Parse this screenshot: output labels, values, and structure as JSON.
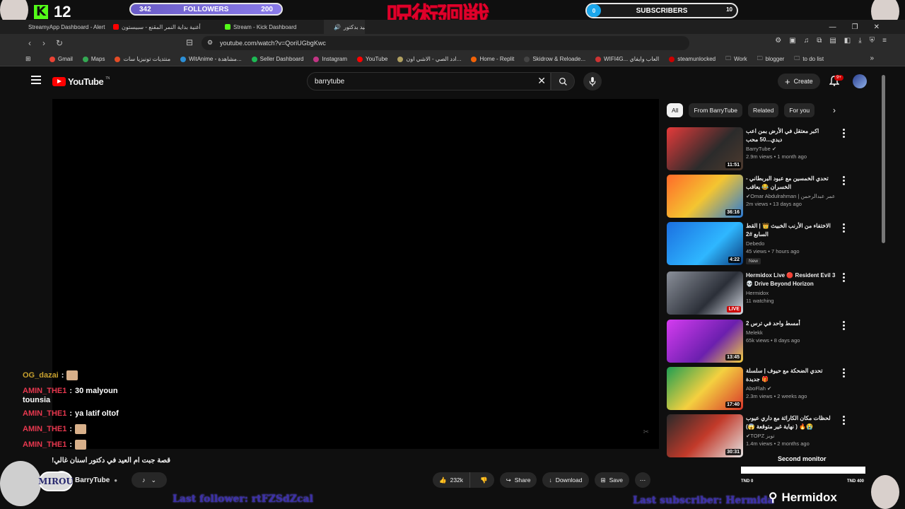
{
  "overlay": {
    "kick_count": "12",
    "followers": {
      "current": "342",
      "label": "FOLLOWERS",
      "goal": "200"
    },
    "subscribers": {
      "current": "0",
      "label": "SUBSCRIBERS",
      "goal": "10"
    },
    "title_art": "呪術廻戦",
    "last_follower": "Last follower: rtFZSdZcal",
    "last_subscriber": "Last subscriber: Hermida",
    "streamer_name": "Hermidox",
    "second_monitor": "Second monitor",
    "tnd_left": "TND 0",
    "tnd_right": "TND 400",
    "mirou_logo": "MIROU"
  },
  "browser": {
    "tabs": [
      {
        "label": "StreamyApp Dashboard - Alert Confi",
        "color": "#2e7bd6"
      },
      {
        "label": "أغنية بداية النمر المقنع - سبيستون",
        "color": "#ff0000"
      },
      {
        "label": "Stream - Kick Dashboard",
        "color": "#53fc18"
      },
      {
        "label": "عيد بدكتور",
        "color": "#ff0000"
      }
    ],
    "url": "youtube.com/watch?v=QoriUGbgKwc",
    "bookmarks": [
      {
        "label": "Gmail",
        "color": "#ea4335"
      },
      {
        "label": "Maps",
        "color": "#34a853"
      },
      {
        "label": "منتديات تونيزيا سات",
        "color": "#e34c26"
      },
      {
        "label": "WitAnime - مشاهدة...",
        "color": "#2c8fd6"
      },
      {
        "label": "Seller Dashboard",
        "color": "#1db954"
      },
      {
        "label": "Instagram",
        "color": "#c13584"
      },
      {
        "label": "YouTube",
        "color": "#ff0000"
      },
      {
        "label": "ادد الصي - الاشي اون...",
        "color": "#b0a060"
      },
      {
        "label": "Home - Replit",
        "color": "#f26207"
      },
      {
        "label": "Skidrow & Reloade...",
        "color": "#444444"
      },
      {
        "label": "WIFI4G... العاب وايفاي",
        "color": "#cc3333"
      },
      {
        "label": "steamunlocked",
        "color": "#cc0000"
      },
      {
        "label": "Work",
        "color": "#999999"
      },
      {
        "label": "blogger",
        "color": "#999999"
      },
      {
        "label": "to do list",
        "color": "#999999"
      }
    ]
  },
  "youtube": {
    "logo_text": "YouTube",
    "logo_suffix": "TN",
    "search_value": "barrytube",
    "create_label": "Create",
    "notification_count": "9+",
    "chips": [
      "All",
      "From BarryTube",
      "Related",
      "For you"
    ],
    "recommendations": [
      {
        "title": "اكبر معتقل في الأرض بمن اعب ديدي...50 محب",
        "channel": "BarryTube ✔",
        "meta": "2.9m views • 1 month ago",
        "duration": "11:51",
        "live": false,
        "new": false,
        "thumb": "linear-gradient(135deg,#e63a3a,#2b2b2b 60%,#4d3a2e)"
      },
      {
        "title": "تحدي الخمسين مع عبود البربطاني - الخسران 😂 يعاقب",
        "channel": "✔Omar Abdulrahman | عمر عبدالرحمن",
        "meta": "2m views • 13 days ago",
        "duration": "36:16",
        "live": false,
        "new": false,
        "thumb": "linear-gradient(135deg,#ff6a2a,#f4c531 50%,#2a7ad6)"
      },
      {
        "title": "الاختفاء من الأرنب الخبيث 👑 | القط السابع #2",
        "channel": "Debedo",
        "meta": "45 views • 7 hours ago",
        "duration": "4:22",
        "live": false,
        "new": true,
        "new_label": "New",
        "thumb": "linear-gradient(135deg,#1b6fe0,#2fb7ff 60%,#0b3b7a)"
      },
      {
        "title": "Hermidox Live 🔴 Resident Evil 3 💀 Drive Beyond Horizon",
        "channel": "Hermidox",
        "meta": "11 watching",
        "duration": "LIVE",
        "live": true,
        "new": false,
        "thumb": "linear-gradient(135deg,#8a8f99,#2b2f38 60%,#d8dde6)"
      },
      {
        "title": "أمسط واحد في ترس 2",
        "channel": "Melekk",
        "meta": "65k views • 8 days ago",
        "duration": "13:45",
        "live": false,
        "new": false,
        "thumb": "linear-gradient(135deg,#d53cf0,#6b1fae 60%,#f4d040)"
      },
      {
        "title": "تحدي الضحكة مع حيوف | سلسلة جديدة 🎁",
        "channel": "AboFlah ✔",
        "meta": "2.3m views • 2 weeks ago",
        "duration": "17:40",
        "live": false,
        "new": false,
        "thumb": "linear-gradient(135deg,#1f9e52,#f4d040 50%,#d8362a)"
      },
      {
        "title": "لحظات مكان الكاراثة مع داري عيوب 😭🔥 ( نهاية غير متوقعة 😱)",
        "channel": "✔TOPZ توبز",
        "meta": "1.4m views • 2 months ago",
        "duration": "30:31",
        "live": false,
        "new": false,
        "thumb": "linear-gradient(135deg,#2a2a2a,#c23a2a 50%,#e4e4e4)"
      }
    ],
    "video_title": "!قصة جبت ام العيد في دكتور اسنان غالي",
    "channel_name": "BarryTube",
    "likes": "232k",
    "share_label": "Share",
    "download_label": "Download",
    "save_label": "Save"
  },
  "chat": [
    {
      "user": "OG_dazai",
      "message": "",
      "emote": true,
      "gold": true
    },
    {
      "user": "AMIN_THE1",
      "message": "30 malyoun",
      "emote": false,
      "gold": false
    },
    {
      "continuation": "tounsia"
    },
    {
      "user": "AMIN_THE1",
      "message": "ya latif oltof",
      "emote": false,
      "gold": false
    },
    {
      "user": "AMIN_THE1",
      "message": "",
      "emote": true,
      "gold": false
    },
    {
      "user": "AMIN_THE1",
      "message": "",
      "emote": true,
      "gold": false
    }
  ]
}
